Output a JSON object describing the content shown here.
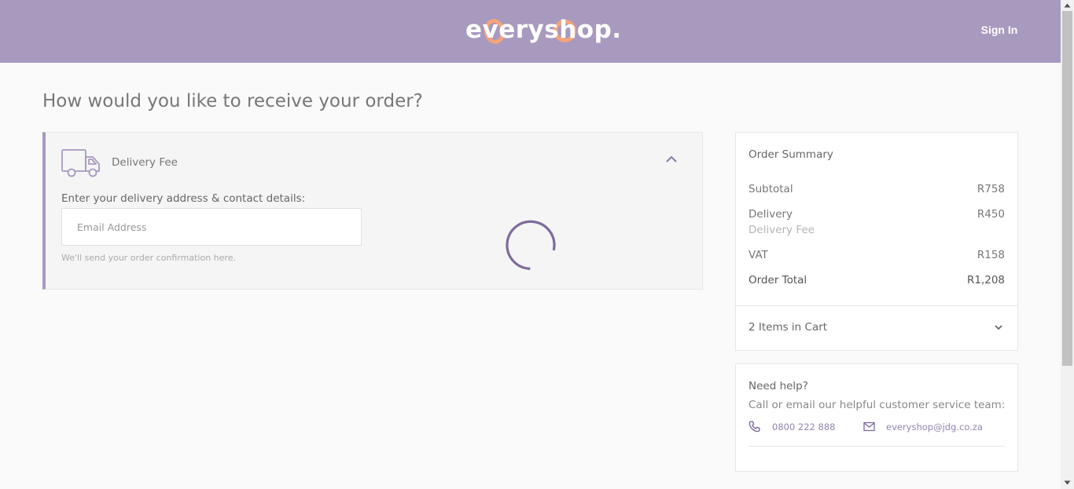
{
  "header": {
    "brand": "everyshop.",
    "sign_in_label": "Sign In",
    "background_color": "#a899be",
    "accent_color": "#f4a47a"
  },
  "page": {
    "title": "How would you like to receive your order?"
  },
  "delivery": {
    "fee_label": "Delivery Fee",
    "address_label": "Enter your delivery address & contact details:",
    "email_placeholder": "Email Address",
    "email_value": "",
    "hint": "We'll send your order confirmation here.",
    "icon": "truck-icon",
    "loading": true
  },
  "summary": {
    "title": "Order Summary",
    "subtotal_label": "Subtotal",
    "subtotal_value": "R758",
    "delivery_label": "Delivery",
    "delivery_value": "R450",
    "delivery_sub": "Delivery Fee",
    "vat_label": "VAT",
    "vat_value": "R158",
    "total_label": "Order Total",
    "total_value": "R1,208",
    "cart_label": "2 Items in Cart"
  },
  "help": {
    "title": "Need help?",
    "text": "Call or email our helpful customer service team:",
    "phone": "0800 222 888",
    "email": "everyshop@jdg.co.za",
    "link_color": "#9385b0"
  }
}
